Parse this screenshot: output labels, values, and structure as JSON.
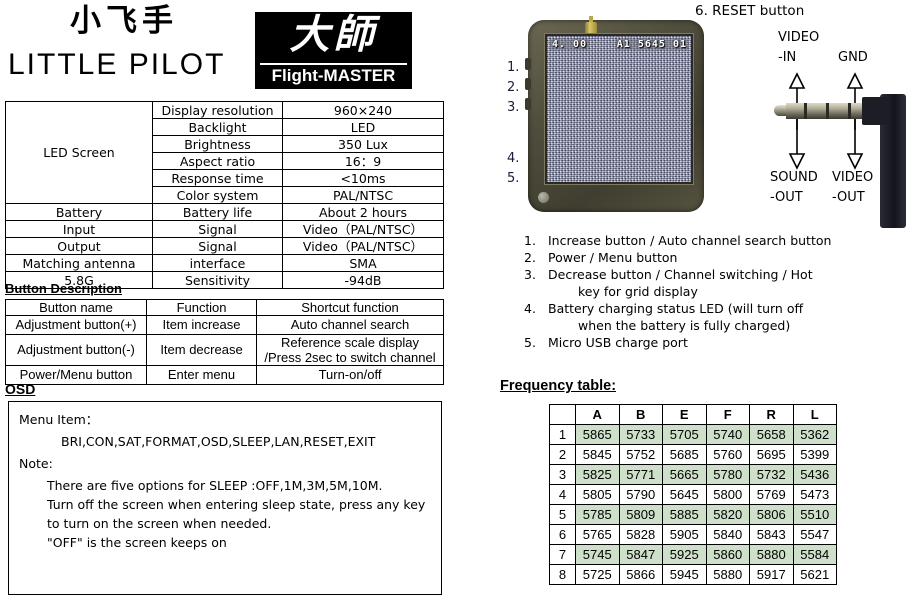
{
  "brand": {
    "chinese_name": "小飞手",
    "english_name": "LITTLE PILOT",
    "logo_chinese": "大師",
    "logo_english": "Flight-MASTER"
  },
  "spec_table": {
    "rows": [
      {
        "group": "LED Screen",
        "group_rowspan": 6,
        "item": "Display resolution",
        "value": "960×240"
      },
      {
        "item": "Backlight",
        "value": "LED"
      },
      {
        "item": "Brightness",
        "value": "350 Lux"
      },
      {
        "item": "Aspect ratio",
        "value": "16：9"
      },
      {
        "item": "Response time",
        "value": "<10ms"
      },
      {
        "item": "Color system",
        "value": "PAL/NTSC"
      },
      {
        "group": "Battery",
        "item": "Battery life",
        "value": "About 2 hours"
      },
      {
        "group": "Input",
        "item": "Signal",
        "value": "Video（PAL/NTSC）"
      },
      {
        "group": "Output",
        "item": "Signal",
        "value": "Video（PAL/NTSC）"
      },
      {
        "group": "Matching antenna",
        "item": "interface",
        "value": "SMA"
      },
      {
        "group": "5.8G",
        "item": "Sensitivity",
        "value": "-94dB"
      }
    ]
  },
  "button_description": {
    "title": "Button Description",
    "headers": [
      "Button name",
      "Function",
      "Shortcut function"
    ],
    "rows": [
      {
        "name": "Adjustment button(+)",
        "function": "Item increase",
        "shortcut": "Auto channel search"
      },
      {
        "name": "Adjustment button(-)",
        "function": "Item decrease",
        "shortcut_line1": "Reference scale display",
        "shortcut_line2": "/Press 2sec to switch channel"
      },
      {
        "name": "Power/Menu button",
        "function": "Enter menu",
        "shortcut": "Turn-on/off"
      }
    ]
  },
  "osd": {
    "title": "OSD",
    "menu_item_label": "Menu Item：",
    "menu_items": "BRI,CON,SAT,FORMAT,OSD,SLEEP,LAN,RESET,EXIT",
    "note_label": "Note:",
    "note_lines": [
      "There are five options for SLEEP :OFF,1M,3M,5M,10M.",
      "Turn off the screen when entering sleep state, press any key",
      " to turn on the screen when needed.",
      "\"OFF\" is the screen keeps on"
    ]
  },
  "device": {
    "reset_label": "6.  RESET button",
    "screen_osd_left": "4. 00",
    "screen_osd_right": "A1  5645  01",
    "callout_numbers": [
      "1.",
      "2.",
      "3.",
      "4.",
      "5."
    ]
  },
  "jack": {
    "video_in_line1": "VIDEO",
    "video_in_line2": "-IN",
    "gnd": "GND",
    "sound_out_line1": "SOUND",
    "sound_out_line2": "-OUT",
    "video_out_line1": "VIDEO",
    "video_out_line2": "-OUT"
  },
  "instructions": [
    {
      "num": "1.",
      "text": "Increase button / Auto channel search button"
    },
    {
      "num": "2.",
      "text": "Power / Menu button"
    },
    {
      "num": "3.",
      "text": "Decrease button  /  Channel switching / Hot",
      "cont": "key for grid display"
    },
    {
      "num": "4.",
      "text": "Battery charging status LED (will turn off",
      "cont": "when the battery is fully charged)"
    },
    {
      "num": "5.",
      "text": "Micro USB charge port"
    }
  ],
  "frequency_table": {
    "title": "Frequency table:",
    "corner": "",
    "columns": [
      "A",
      "B",
      "E",
      "F",
      "R",
      "L"
    ],
    "rows": [
      {
        "label": "1",
        "values": [
          "5865",
          "5733",
          "5705",
          "5740",
          "5658",
          "5362"
        ],
        "shaded": true
      },
      {
        "label": "2",
        "values": [
          "5845",
          "5752",
          "5685",
          "5760",
          "5695",
          "5399"
        ],
        "shaded": false
      },
      {
        "label": "3",
        "values": [
          "5825",
          "5771",
          "5665",
          "5780",
          "5732",
          "5436"
        ],
        "shaded": true
      },
      {
        "label": "4",
        "values": [
          "5805",
          "5790",
          "5645",
          "5800",
          "5769",
          "5473"
        ],
        "shaded": false
      },
      {
        "label": "5",
        "values": [
          "5785",
          "5809",
          "5885",
          "5820",
          "5806",
          "5510"
        ],
        "shaded": true
      },
      {
        "label": "6",
        "values": [
          "5765",
          "5828",
          "5905",
          "5840",
          "5843",
          "5547"
        ],
        "shaded": false
      },
      {
        "label": "7",
        "values": [
          "5745",
          "5847",
          "5925",
          "5860",
          "5880",
          "5584"
        ],
        "shaded": true
      },
      {
        "label": "8",
        "values": [
          "5725",
          "5866",
          "5945",
          "5880",
          "5917",
          "5621"
        ],
        "shaded": false
      }
    ],
    "shade_color": "#cfe0ca"
  }
}
